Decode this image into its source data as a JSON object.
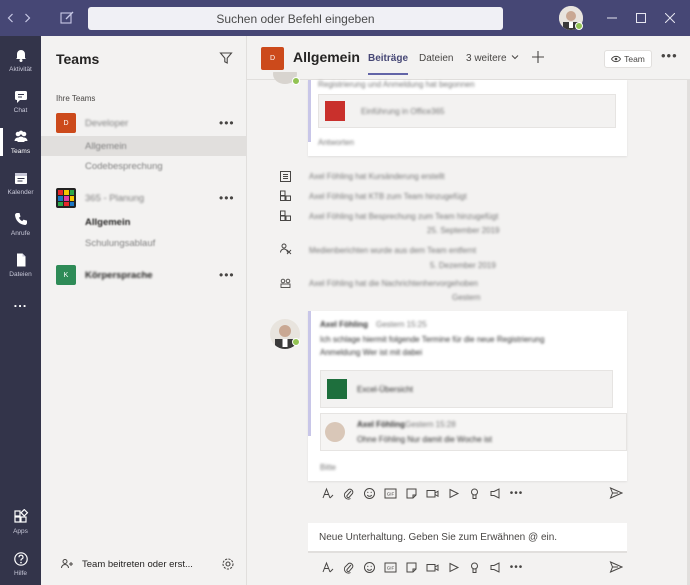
{
  "titlebar": {
    "search_placeholder": "Suchen oder Befehl eingeben",
    "back_icon": "chevron-left-icon",
    "forward_icon": "chevron-right-icon",
    "compose_icon": "compose-icon",
    "window_controls": [
      "minimize-icon",
      "maximize-icon",
      "close-icon"
    ]
  },
  "rail": {
    "items": [
      {
        "label": "Aktivität",
        "icon": "bell-icon"
      },
      {
        "label": "Chat",
        "icon": "chat-icon"
      },
      {
        "label": "Teams",
        "icon": "teams-icon",
        "active": true
      },
      {
        "label": "Kalender",
        "icon": "calendar-icon"
      },
      {
        "label": "Anrufe",
        "icon": "phone-icon"
      },
      {
        "label": "Dateien",
        "icon": "file-icon"
      },
      {
        "label": "...",
        "icon": "more-icon"
      }
    ],
    "bottom": [
      {
        "label": "Apps",
        "icon": "apps-icon"
      },
      {
        "label": "Hilfe",
        "icon": "help-icon"
      }
    ]
  },
  "panel": {
    "title": "Teams",
    "section_label": "Ihre Teams",
    "teams": [
      {
        "tile": "D",
        "name": "Developer",
        "color": "#cc4a1b",
        "channels": [
          {
            "name": "Allgemein",
            "active": true
          },
          {
            "name": "Codebesprechung"
          }
        ]
      },
      {
        "tile": "",
        "name": "365 - Planung",
        "color": "#222222",
        "channels": [
          {
            "name": "Allgemein",
            "bold": true
          },
          {
            "name": "Schulungsablauf"
          }
        ]
      },
      {
        "tile": "K",
        "name": "Körpersprache",
        "color": "#2e8b57",
        "channels": []
      }
    ],
    "footer_label": "Team beitreten oder erst..."
  },
  "header": {
    "channel_tile": "D",
    "channel_name": "Allgemein",
    "tabs": [
      "Beiträge",
      "Dateien",
      "3 weitere"
    ],
    "team_button": "Team"
  },
  "feed": {
    "sys_messages": [
      "Axel Föhling hat Kursänderung erstellt",
      "Axel Föhling hat KTB zum Team hinzugefügt",
      "Axel Föhling hat Besprechung zum Team hinzugefügt",
      "Medienberichten wurde aus dem Team entfernt",
      "Axel Föhling hat die Nachrichtenhervorgehoben"
    ],
    "post_author": "Axel Föhling",
    "compose_placeholder": "Neue Unterhaltung. Geben Sie zum Erwähnen @ ein."
  }
}
